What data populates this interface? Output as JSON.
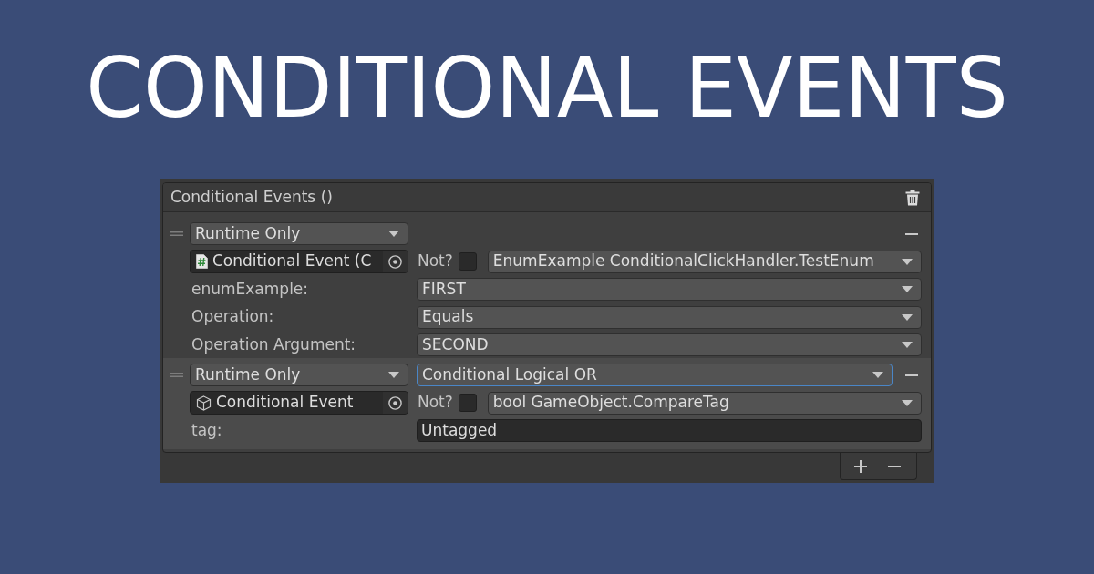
{
  "title": "CONDITIONAL EVENTS",
  "panel": {
    "header": "Conditional Events ()",
    "elements": [
      {
        "selected": false,
        "call_state": "Runtime Only",
        "target": {
          "kind": "script",
          "name": "Conditional Event (C"
        },
        "not": {
          "label": "Not?",
          "checked": false
        },
        "method": "EnumExample ConditionalClickHandler.TestEnum",
        "params": [
          {
            "kind": "dropdown",
            "label": "enumExample:",
            "value": "FIRST"
          },
          {
            "kind": "dropdown",
            "label": "Operation:",
            "value": "Equals"
          },
          {
            "kind": "dropdown",
            "label": "Operation Argument:",
            "value": "SECOND"
          }
        ]
      },
      {
        "selected": true,
        "call_state": "Runtime Only",
        "operator": {
          "value": "Conditional Logical OR",
          "focused": true
        },
        "target": {
          "kind": "gameobject",
          "name": "Conditional Event"
        },
        "not": {
          "label": "Not?",
          "checked": false
        },
        "method": "bool GameObject.CompareTag",
        "params": [
          {
            "kind": "text",
            "label": "tag:",
            "value": "Untagged"
          }
        ]
      }
    ]
  }
}
